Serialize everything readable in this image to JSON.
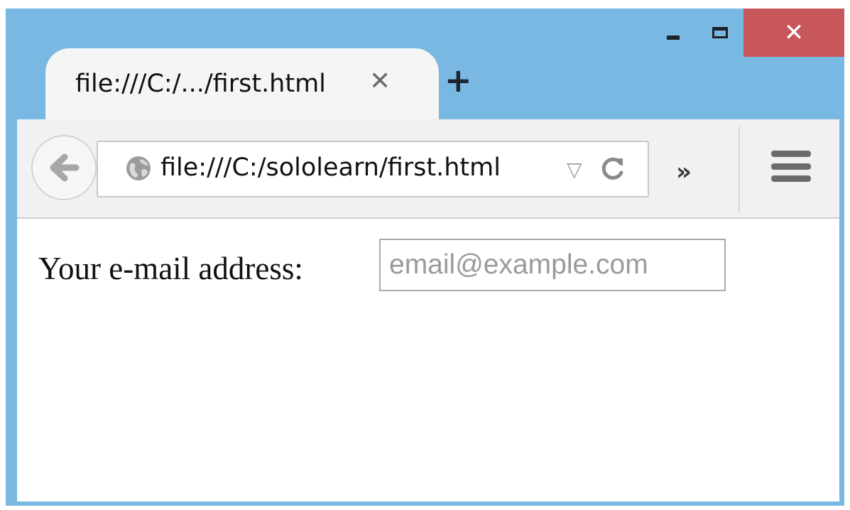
{
  "window": {
    "controls": {
      "minimize_icon": "minimize-icon",
      "maximize_icon": "maximize-icon",
      "close_glyph": "✕"
    },
    "frame_color": "#79b8e2",
    "close_color": "#c8575b"
  },
  "tab": {
    "title": "file:///C:/.../first.html",
    "close_glyph": "✕",
    "new_tab_glyph": "+"
  },
  "toolbar": {
    "back_icon": "back-arrow-icon",
    "url": "file:///C:/sololearn/first.html",
    "dropmarker_glyph": "▽",
    "overflow_glyph": "»",
    "menu_icon": "hamburger-menu-icon"
  },
  "page": {
    "label": "Your e-mail address:",
    "email_input": {
      "value": "",
      "placeholder": "email@example.com"
    }
  }
}
